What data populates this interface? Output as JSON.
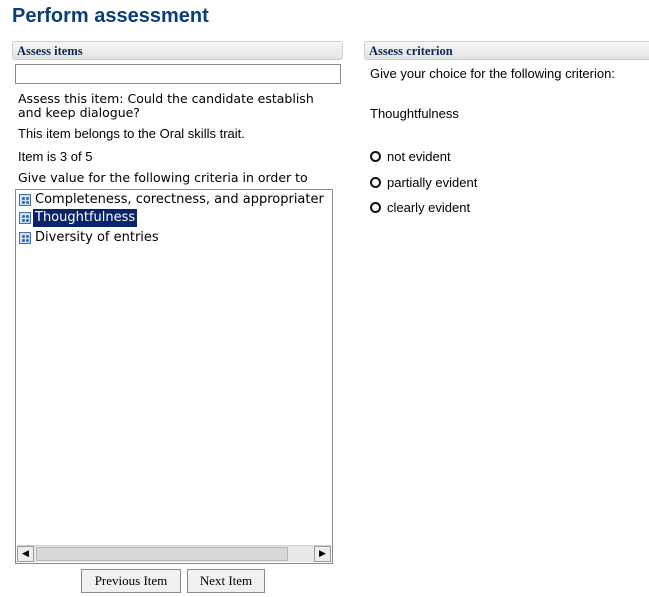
{
  "page": {
    "title": "Perform assessment"
  },
  "left_panel": {
    "header": "Assess items",
    "search_value": "",
    "question": "Assess this item: Could the candidate establish and keep dialogue?",
    "belongs": "This item belongs to the Oral skills trait.",
    "item_count": "Item is 3 of 5",
    "give_value": "Give value for the following criteria in order to",
    "criteria": [
      {
        "label": "Completeness, corectness, and appropriater",
        "selected": false
      },
      {
        "label": "Thoughtfulness",
        "selected": true
      },
      {
        "label": "Diversity of entries",
        "selected": false
      }
    ],
    "scrollbar": {
      "left_arrow": "◀",
      "right_arrow": "▶"
    }
  },
  "buttons": {
    "previous": "Previous Item",
    "next": "Next Item"
  },
  "right_panel": {
    "header": "Assess criterion",
    "instruction": "Give your choice for the following criterion:",
    "criterion": "Thoughtfulness",
    "options": [
      "not evident",
      "partially evident",
      "clearly evident"
    ]
  },
  "icons": {
    "criterion": "criterion-icon"
  },
  "colors": {
    "title": "#0b3d7a",
    "selection": "#0a246a"
  }
}
